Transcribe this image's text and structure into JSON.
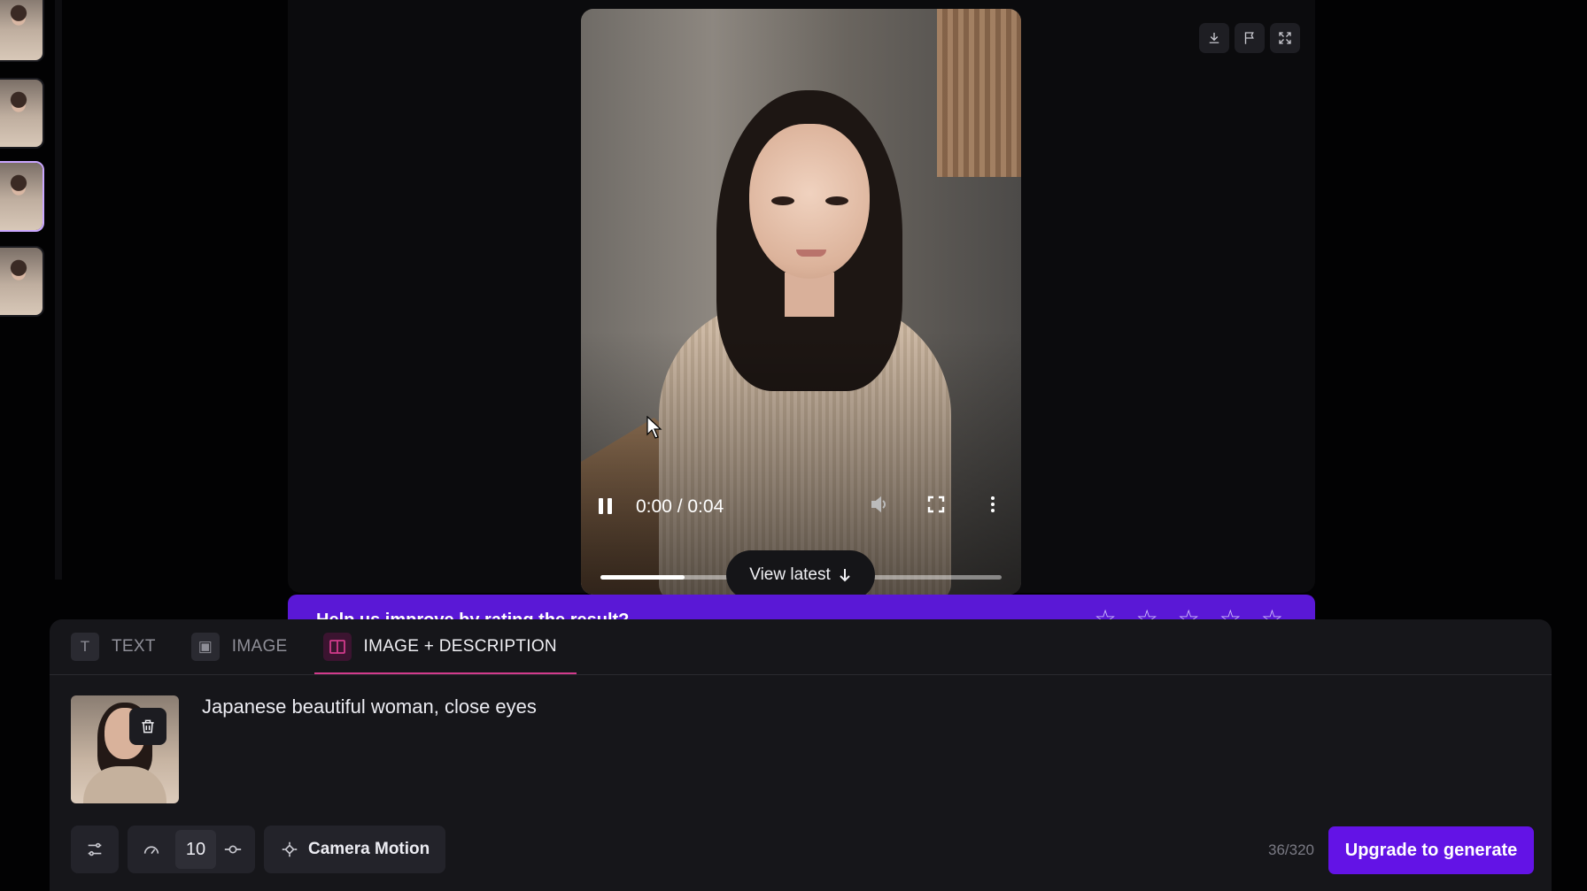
{
  "top_tools": {
    "download_icon": "download-icon",
    "flag_icon": "flag-icon",
    "expand_icon": "expand-icon"
  },
  "video": {
    "time": "0:00 / 0:04",
    "progress": 0.21
  },
  "view_latest": {
    "label": "View latest"
  },
  "rating_bar": {
    "question": "Help us improve by rating the result?",
    "stars": [
      "☆",
      "☆",
      "☆",
      "☆",
      "☆"
    ]
  },
  "tabs": [
    {
      "label": "TEXT",
      "icon": "T"
    },
    {
      "label": "IMAGE",
      "icon": "▣"
    },
    {
      "label": "IMAGE + DESCRIPTION",
      "icon": "◫"
    }
  ],
  "prompt": {
    "text": "Japanese beautiful woman, close eyes"
  },
  "controls": {
    "motion_value": "10",
    "camera_label": "Camera Motion",
    "counter": "36/320",
    "upgrade_label": "Upgrade to generate"
  },
  "colors": {
    "accent": "#6313e6",
    "rating_bar": "#5a18d6",
    "active_tab_underline": "#d23b8c"
  }
}
